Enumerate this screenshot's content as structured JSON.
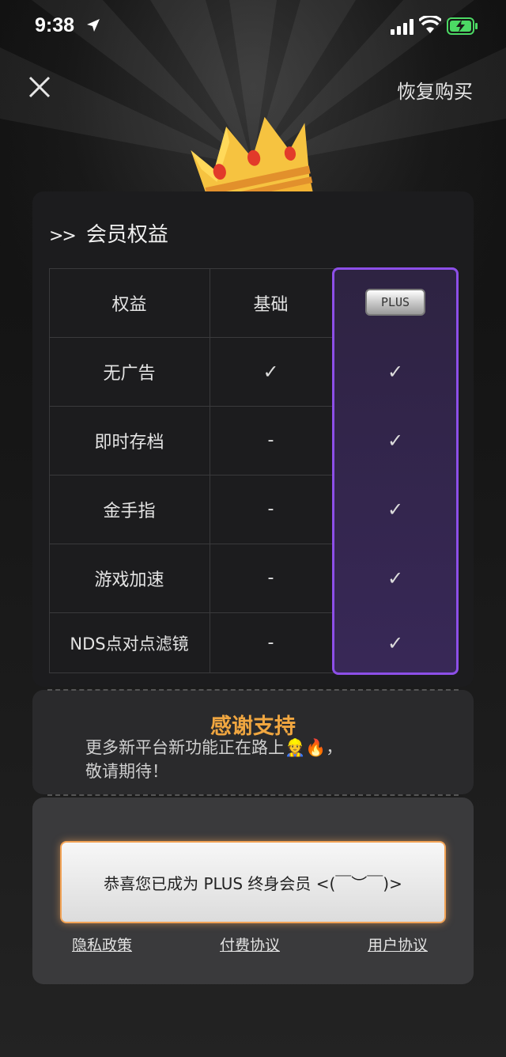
{
  "status_bar": {
    "time": "9:38"
  },
  "header": {
    "restore_label": "恢复购买"
  },
  "benefits": {
    "title": "会员权益",
    "arrows": ">>",
    "columns": [
      "权益",
      "基础",
      "PLUS"
    ],
    "rows": [
      {
        "name": "无广告",
        "basic": "✓",
        "plus": "✓"
      },
      {
        "name": "即时存档",
        "basic": "-",
        "plus": "✓"
      },
      {
        "name": "金手指",
        "basic": "-",
        "plus": "✓"
      },
      {
        "name": "游戏加速",
        "basic": "-",
        "plus": "✓"
      },
      {
        "name": "NDS点对点滤镜",
        "basic": "-",
        "plus": "✓"
      }
    ]
  },
  "thanks": {
    "title": "感谢支持",
    "line1": "更多新平台新功能正在路上👷🔥，",
    "line2": "敬请期待！"
  },
  "membership_button": "恭喜您已成为 PLUS 终身会员 <(￣︶￣)>",
  "links": {
    "privacy": "隐私政策",
    "payment": "付费协议",
    "user": "用户协议"
  },
  "colors": {
    "accent_purple": "#8d4fe8",
    "thanks_orange": "#f0a640",
    "button_glow": "#f2a356"
  }
}
